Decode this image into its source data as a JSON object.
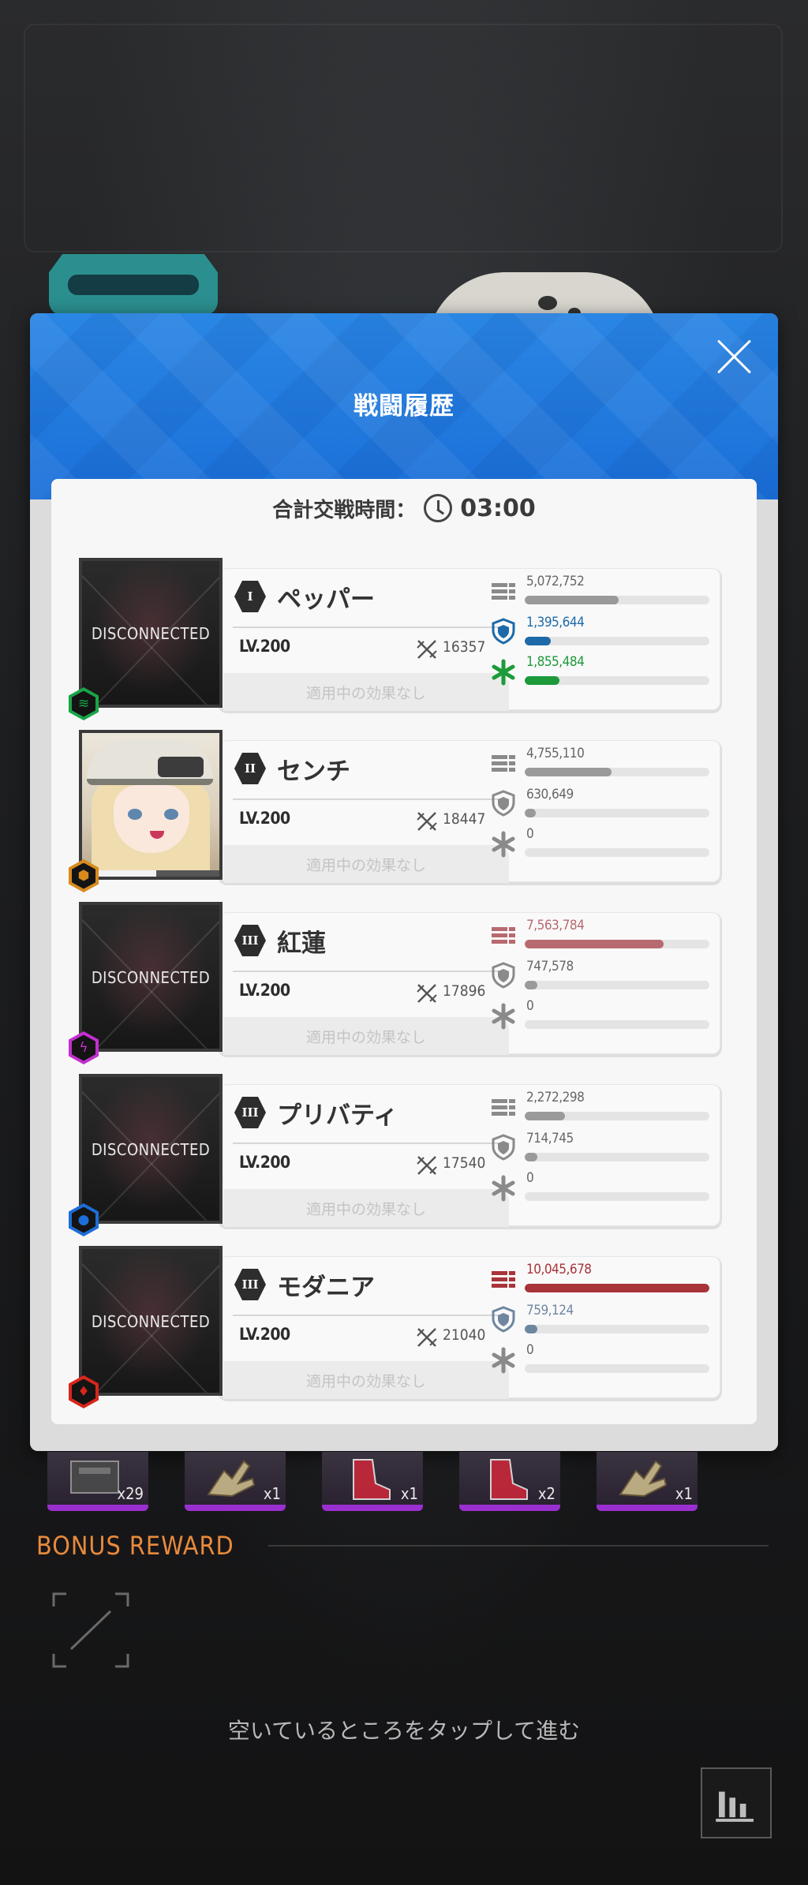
{
  "modal": {
    "title": "戦闘履歴",
    "time_label": "合計交戦時間：",
    "time_value": "03:00"
  },
  "entries": [
    {
      "rank": "I",
      "name": "ペッパー",
      "level": "LV.200",
      "power": "16357",
      "disconnected": true,
      "disconnected_label": "DISCONNECTED",
      "element": "wind",
      "element_color": "#18a548",
      "effect": "適用中の効果なし",
      "damage": "5,072,752",
      "damage_ratio": 0.51,
      "damage_color": "#9a9a9a",
      "shield": "1,395,644",
      "shield_ratio": 0.14,
      "shield_color": "#1e6aa8",
      "heal": "1,855,484",
      "heal_ratio": 0.19,
      "heal_color": "#1d9a3a"
    },
    {
      "rank": "II",
      "name": "センチ",
      "level": "LV.200",
      "power": "18447",
      "disconnected": false,
      "disconnected_label": "",
      "element": "iron",
      "element_color": "#d98a1d",
      "effect": "適用中の効果なし",
      "damage": "4,755,110",
      "damage_ratio": 0.47,
      "damage_color": "#9a9a9a",
      "shield": "630,649",
      "shield_ratio": 0.06,
      "shield_color": "#9a9a9a",
      "heal": "0",
      "heal_ratio": 0,
      "heal_color": "#9a9a9a"
    },
    {
      "rank": "III",
      "name": "紅蓮",
      "level": "LV.200",
      "power": "17896",
      "disconnected": true,
      "disconnected_label": "DISCONNECTED",
      "element": "electric",
      "element_color": "#c32fd0",
      "effect": "適用中の効果なし",
      "damage": "7,563,784",
      "damage_ratio": 0.75,
      "damage_color": "#b76a6f",
      "shield": "747,578",
      "shield_ratio": 0.07,
      "shield_color": "#9a9a9a",
      "heal": "0",
      "heal_ratio": 0,
      "heal_color": "#9a9a9a"
    },
    {
      "rank": "III",
      "name": "プリバティ",
      "level": "LV.200",
      "power": "17540",
      "disconnected": true,
      "disconnected_label": "DISCONNECTED",
      "element": "water",
      "element_color": "#1d6ed8",
      "effect": "適用中の効果なし",
      "damage": "2,272,298",
      "damage_ratio": 0.22,
      "damage_color": "#9a9a9a",
      "shield": "714,745",
      "shield_ratio": 0.07,
      "shield_color": "#9a9a9a",
      "heal": "0",
      "heal_ratio": 0,
      "heal_color": "#9a9a9a"
    },
    {
      "rank": "III",
      "name": "モダニア",
      "level": "LV.200",
      "power": "21040",
      "disconnected": true,
      "disconnected_label": "DISCONNECTED",
      "element": "fire",
      "element_color": "#d8261d",
      "effect": "適用中の効果なし",
      "damage": "10,045,678",
      "damage_ratio": 1.0,
      "damage_color": "#a8343a",
      "shield": "759,124",
      "shield_ratio": 0.07,
      "shield_color": "#6f86a0",
      "heal": "0",
      "heal_ratio": 0,
      "heal_color": "#9a9a9a"
    }
  ],
  "rewards": [
    {
      "count": "x29",
      "art": "crate"
    },
    {
      "count": "x1",
      "art": "claw"
    },
    {
      "count": "x1",
      "art": "boot-red"
    },
    {
      "count": "x2",
      "art": "boot-red"
    },
    {
      "count": "x1",
      "art": "claw"
    }
  ],
  "bonus": {
    "title": "BONUS REWARD"
  },
  "footer": {
    "tap_hint": "空いているところをタップして進む"
  },
  "icons": {
    "close": "close-icon",
    "clock": "clock-icon",
    "sword": "crossed-swords-icon",
    "damage": "bullets-icon",
    "shield": "shield-icon",
    "heal": "heal-star-icon",
    "expand": "expand-icon",
    "stats": "bar-chart-icon"
  }
}
